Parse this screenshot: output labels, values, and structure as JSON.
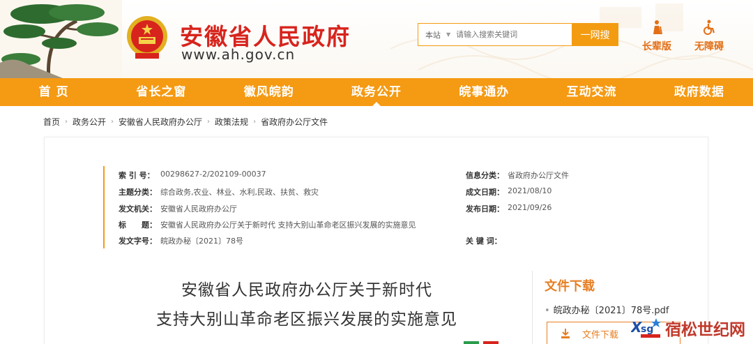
{
  "header": {
    "site_title": "安徽省人民政府",
    "site_url": "www.ah.gov.cn",
    "search": {
      "scope": "本站",
      "placeholder": "请输入搜索关键词",
      "button_label": "一网搜"
    },
    "utilities": [
      {
        "label": "长辈版",
        "icon": "elder-person-icon"
      },
      {
        "label": "无障碍",
        "icon": "wheelchair-icon"
      }
    ]
  },
  "nav": {
    "items": [
      {
        "label": "首 页"
      },
      {
        "label": "省长之窗"
      },
      {
        "label": "徽风皖韵"
      },
      {
        "label": "政务公开",
        "active": true
      },
      {
        "label": "皖事通办"
      },
      {
        "label": "互动交流"
      },
      {
        "label": "政府数据"
      }
    ]
  },
  "breadcrumb": [
    "首页",
    "政务公开",
    "安徽省人民政府办公厅",
    "政策法规",
    "省政府办公厅文件"
  ],
  "meta": {
    "index_no": {
      "label": "索 引 号：",
      "value": "00298627-2/202109-00037"
    },
    "subject": {
      "label": "主题分类：",
      "value": "综合政务,农业、林业、水利,民政、扶贫、救灾"
    },
    "issuer": {
      "label": "发文机关：",
      "value": "安徽省人民政府办公厅"
    },
    "title": {
      "label": "标　　题：",
      "value": "安徽省人民政府办公厅关于新时代 支持大别山革命老区振兴发展的实施意见"
    },
    "doc_no": {
      "label": "发文字号：",
      "value": "皖政办秘〔2021〕78号"
    },
    "info_category": {
      "label": "信息分类：",
      "value": "省政府办公厅文件"
    },
    "created_date": {
      "label": "成文日期：",
      "value": "2021/08/10"
    },
    "published_date": {
      "label": "发布日期：",
      "value": "2021/09/26"
    },
    "keywords": {
      "label": "关 键 词：",
      "value": ""
    }
  },
  "document": {
    "title_line1": "安徽省人民政府办公厅关于新时代",
    "title_line2": "支持大别山革命老区振兴发展的实施意见"
  },
  "download": {
    "title": "文件下载",
    "file_name": "皖政办秘〔2021〕78号.pdf",
    "button_label": "文件下载"
  },
  "watermark": {
    "text": "宿松世纪网"
  },
  "colors": {
    "accent_orange": "#f59a13",
    "title_red": "#d7241d",
    "download_orange": "#e67e22"
  }
}
